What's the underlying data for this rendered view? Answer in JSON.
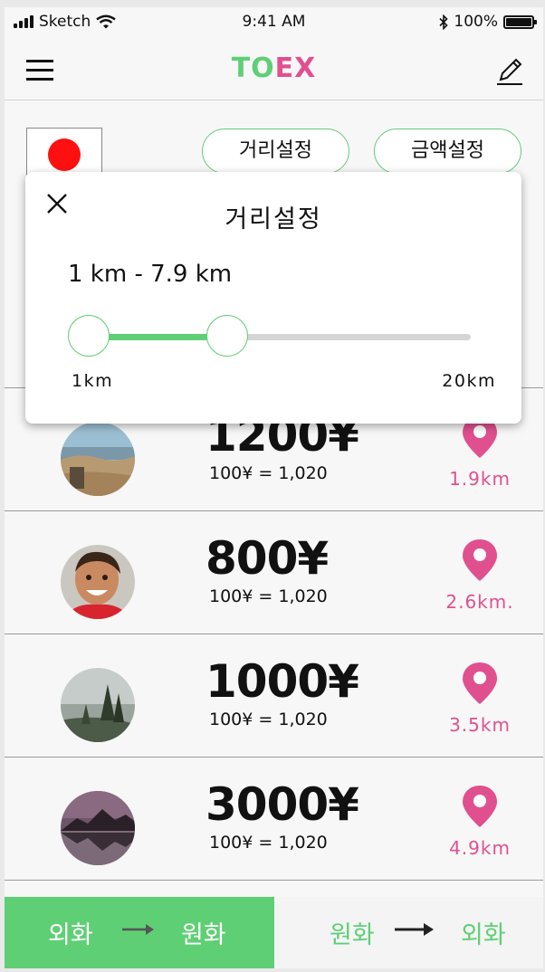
{
  "status": {
    "carrier": "Sketch",
    "time": "9:41 AM",
    "battery": "100%",
    "battery_level": 1.0
  },
  "nav": {
    "logo_a": "TO",
    "logo_b": "EX"
  },
  "filters": {
    "distance_label": "거리설정",
    "amount_label": "금액설정"
  },
  "popup": {
    "title": "거리설정",
    "range_text": "1 km - 7.9 km",
    "min_label": "1km",
    "max_label": "20km",
    "min_value_km": 1,
    "max_value_km": 20,
    "low_km": 1,
    "high_km": 7.9
  },
  "list": [
    {
      "amount": "1200¥",
      "rate": "100¥ = 1,020",
      "distance": "1.9km"
    },
    {
      "amount": "800¥",
      "rate": "100¥ = 1,020",
      "distance": "2.6km."
    },
    {
      "amount": "1000¥",
      "rate": "100¥ = 1,020",
      "distance": "3.5km"
    },
    {
      "amount": "3000¥",
      "rate": "100¥ = 1,020",
      "distance": "4.9km"
    }
  ],
  "bottom": {
    "left_from": "외화",
    "left_to": "원화",
    "right_from": "원화",
    "right_to": "외화"
  },
  "colors": {
    "green": "#5fcf76",
    "pink": "#e0508f",
    "flag_red": "#ff1010"
  }
}
